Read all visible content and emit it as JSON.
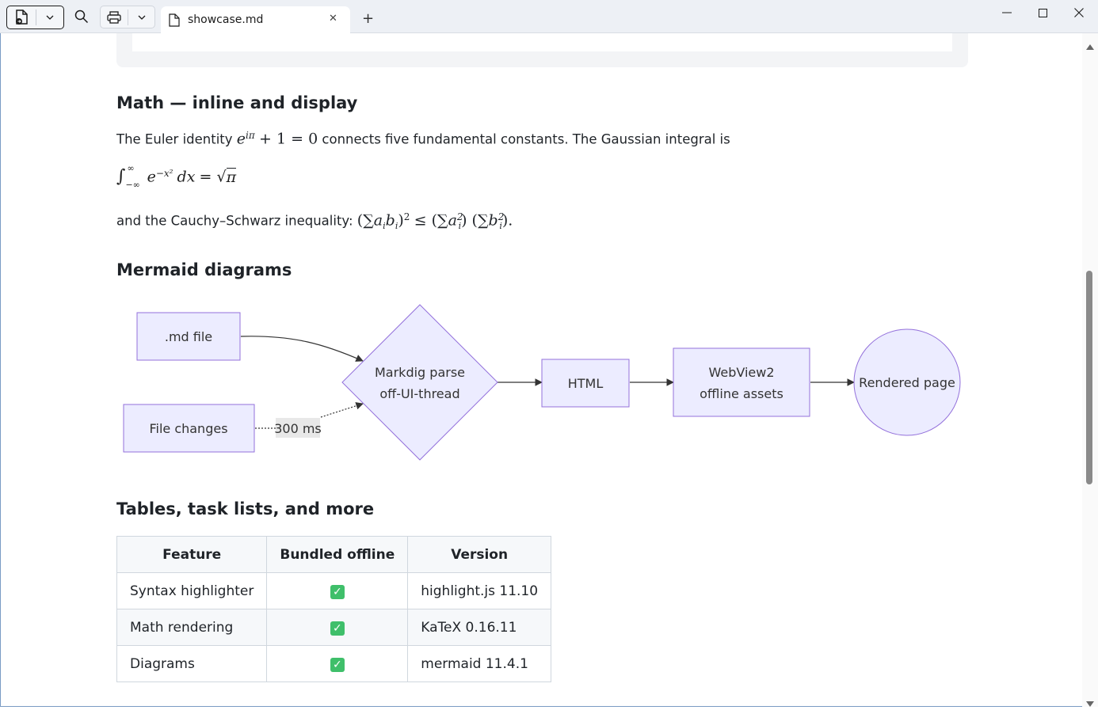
{
  "window": {
    "tab_title": "showcase.md",
    "tab_close": "✕",
    "new_tab": "+",
    "minimize": "—",
    "maximize": "☐",
    "close": "✕"
  },
  "math": {
    "heading": "Math — inline and display",
    "line1_prefix": "The Euler identity",
    "line1_suffix": "connects five fundamental constants. The Gaussian integral is",
    "line3_prefix": "and the Cauchy–Schwarz inequality:"
  },
  "mermaid": {
    "heading": "Mermaid diagrams",
    "nodes": {
      "md_file": ".md file",
      "file_changes": "File changes",
      "parse_line1": "Markdig parse",
      "parse_line2": "off-UI-thread",
      "html": "HTML",
      "webview_line1": "WebView2",
      "webview_line2": "offline assets",
      "rendered": "Rendered page"
    },
    "edge_label": "300 ms"
  },
  "tables": {
    "heading": "Tables, task lists, and more",
    "columns": [
      "Feature",
      "Bundled offline",
      "Version"
    ],
    "rows": [
      {
        "feature": "Syntax highlighter",
        "bundled": "✓",
        "version": "highlight.js 11.10"
      },
      {
        "feature": "Math rendering",
        "bundled": "✓",
        "version": "KaTeX 0.16.11"
      },
      {
        "feature": "Diagrams",
        "bundled": "✓",
        "version": "mermaid 11.4.1"
      }
    ]
  },
  "colors": {
    "node_fill": "#ececff",
    "node_stroke": "#9370db",
    "check_green": "#3fbf6a",
    "titlebar": "#edf0f5"
  }
}
